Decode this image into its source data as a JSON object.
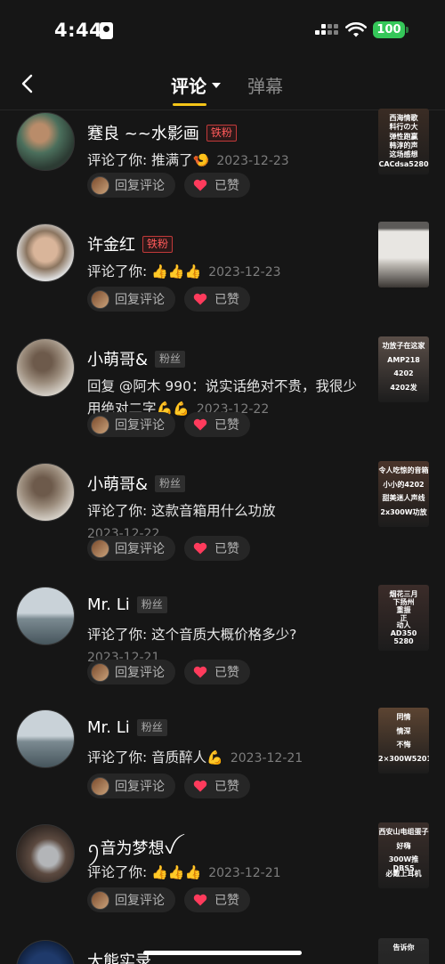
{
  "status": {
    "time": "4:44",
    "battery": "100"
  },
  "nav": {
    "tab_comments": "评论",
    "tab_danmaku": "弹幕"
  },
  "common": {
    "reply_label": "回复评论",
    "liked_label": "已赞"
  },
  "comments": [
    {
      "name": "蹇良 ~~水影画",
      "badge": "铁粉",
      "badge_type": "iron",
      "text": "评论了你: 推满了",
      "emoji": "🍤",
      "date": "2023-12-23",
      "date_inline": true,
      "thumb_text": [
        "西海情歌",
        "料行の大",
        "弹性跑赢",
        "韩淳的声",
        "这场感想",
        "CACdsa5280"
      ],
      "thumb_color": "#3a2c24"
    },
    {
      "name": "许金红",
      "badge": "铁粉",
      "badge_type": "iron",
      "text": "评论了你: ",
      "emoji": "👍👍👍",
      "date": "2023-12-23",
      "date_inline": true,
      "thumb_text": [],
      "thumb_color": "#8d8a86"
    },
    {
      "name": "小萌哥&",
      "badge": "粉丝",
      "badge_type": "fan",
      "text": "回复 @阿木 990：说实话绝对不贵，我很少用绝对二字",
      "emoji": "💪💪",
      "date": "2023-12-22",
      "date_inline": true,
      "thumb_text": [
        "功放子在这家",
        "AMP218",
        "4202",
        "4202发"
      ],
      "thumb_color": "#5a4e48"
    },
    {
      "name": "小萌哥&",
      "badge": "粉丝",
      "badge_type": "fan",
      "text": "评论了你: 这款音箱用什么功放",
      "emoji": "",
      "date": "2023-12-22",
      "date_inline": false,
      "thumb_text": [
        "令人吃惊的音箱",
        "小小的4202",
        "甜美迷人声线",
        "2x300W功放"
      ],
      "thumb_color": "#4a342a"
    },
    {
      "name": "Mr. Li",
      "badge": "粉丝",
      "badge_type": "fan",
      "text": "评论了你: 这个音质大概价格多少?",
      "emoji": "",
      "date": "2023-12-21",
      "date_inline": false,
      "thumb_text": [
        "烟花三月",
        "下扬州",
        "重振",
        "正",
        "动人",
        "AD350",
        "5280"
      ],
      "thumb_color": "#3b2c29"
    },
    {
      "name": "Mr. Li",
      "badge": "粉丝",
      "badge_type": "fan",
      "text": "评论了你: 音质醉人",
      "emoji": "💪",
      "date": "2023-12-21",
      "date_inline": true,
      "thumb_text": [
        "同情",
        "情深",
        "不悔",
        "2×300W5201"
      ],
      "thumb_color": "#5c4432"
    },
    {
      "name": "ꪆ音为梦想ꪜ",
      "badge": "",
      "badge_type": "",
      "text": "评论了你: ",
      "emoji": "👍👍👍",
      "date": "2023-12-21",
      "date_inline": true,
      "thumb_text": [
        "西安山电组蛋子",
        "好嗨",
        "300W推DBS5",
        "必戴上耳机"
      ],
      "thumb_color": "#3a2e2a"
    },
    {
      "name": "大熊实录",
      "badge": "",
      "badge_type": "",
      "text": "",
      "emoji": "",
      "date": "",
      "date_inline": true,
      "thumb_text": [
        "告诉你"
      ],
      "thumb_color": "#2a2a2a"
    }
  ]
}
